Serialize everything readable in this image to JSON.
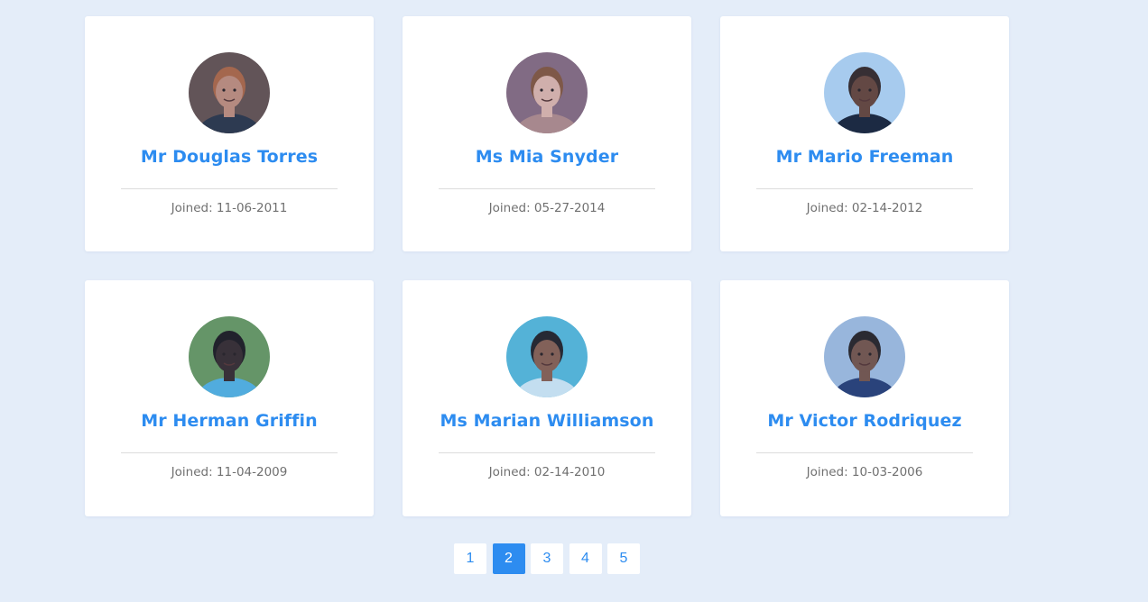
{
  "users": [
    {
      "name": "Mr Douglas Torres",
      "joined": "Joined: 11-06-2011",
      "bg": "#6a5148",
      "skin": "#c98f76",
      "hair": "#b5673d",
      "shirt": "#2e3440"
    },
    {
      "name": "Ms Mia Snyder",
      "joined": "Joined: 05-27-2014",
      "bg": "#8e6c7a",
      "skin": "#e8b9a8",
      "hair": "#8a5636",
      "shirt": "#b98d86"
    },
    {
      "name": "Mr Mario Freeman",
      "joined": "Joined: 02-14-2012",
      "bg": "#b9d9f3",
      "skin": "#6b4431",
      "hair": "#3a271f",
      "shirt": "#1b2230"
    },
    {
      "name": "Mr Herman Griffin",
      "joined": "Joined: 11-04-2009",
      "bg": "#6e9b5b",
      "skin": "#3b2a25",
      "hair": "#201816",
      "shirt": "#57b5e1"
    },
    {
      "name": "Ms Marian Williamson",
      "joined": "Joined: 02-14-2010",
      "bg": "#5bbcd9",
      "skin": "#8f6049",
      "hair": "#26201f",
      "shirt": "#d9eef5"
    },
    {
      "name": "Mr Victor Rodriquez",
      "joined": "Joined: 10-03-2006",
      "bg": "#a8c1de",
      "skin": "#7b5543",
      "hair": "#2b211d",
      "shirt": "#2b3e70"
    }
  ],
  "pagination": {
    "pages": [
      "1",
      "2",
      "3",
      "4",
      "5"
    ],
    "current": "2"
  }
}
